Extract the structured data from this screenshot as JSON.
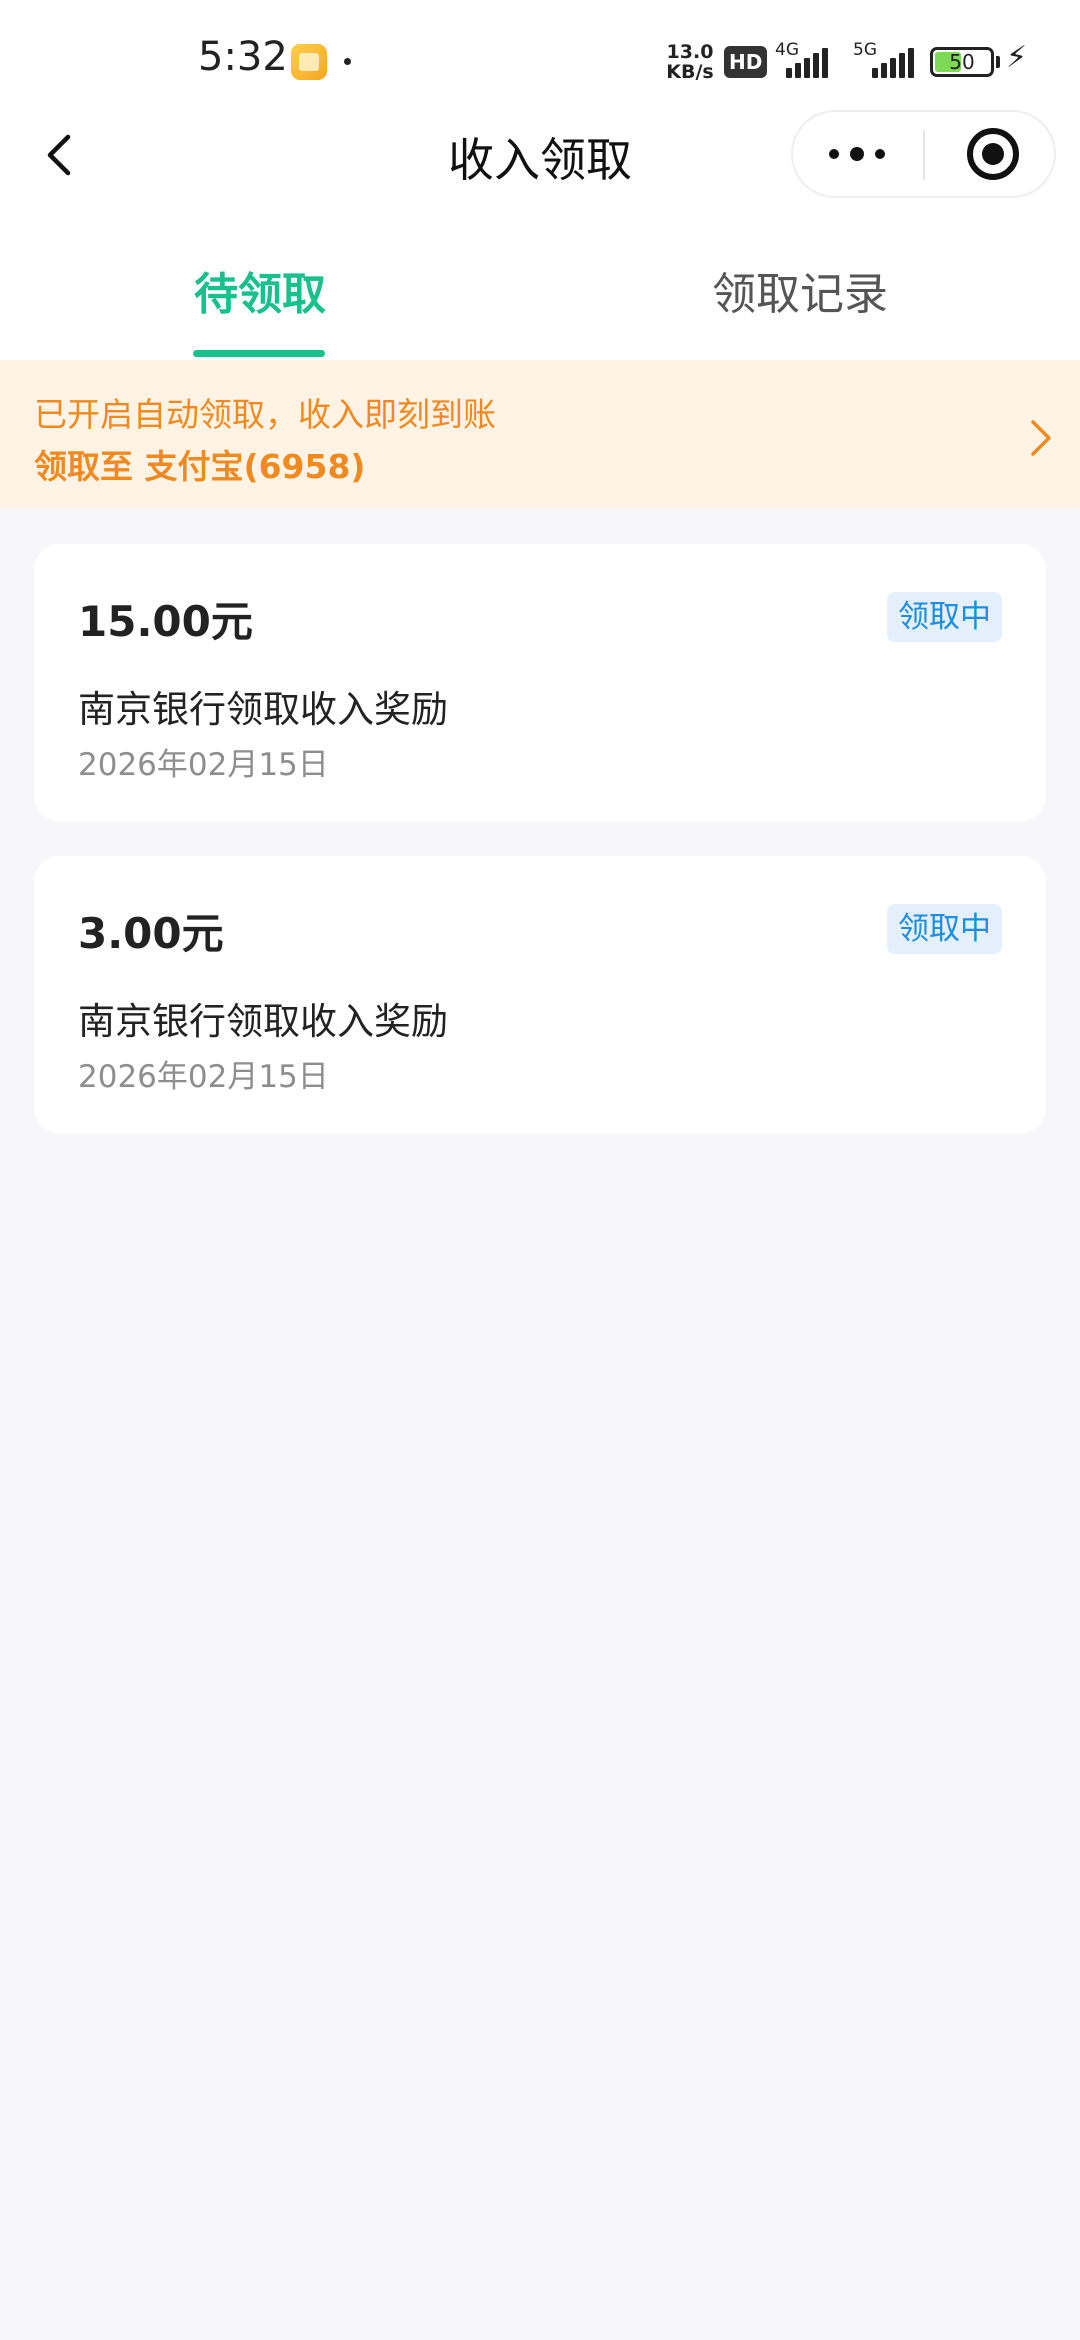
{
  "status_bar": {
    "time": "5:32",
    "app_icon": "gallery-icon",
    "speed_value": "13.0",
    "speed_unit": "KB/s",
    "hd_label": "HD",
    "network_1": "4G",
    "network_2": "5G",
    "battery_level": "50",
    "charging_icon": "bolt-icon"
  },
  "nav": {
    "back_icon": "chevron-left-icon",
    "title": "收入领取",
    "more_icon": "more-dots-icon",
    "close_icon": "record-circle-icon"
  },
  "tabs": [
    {
      "label": "待领取",
      "active": true
    },
    {
      "label": "领取记录",
      "active": false
    }
  ],
  "notice": {
    "line1": "已开启自动领取，收入即刻到账",
    "line2": "领取至 支付宝(6958)",
    "arrow_icon": "chevron-right-icon"
  },
  "records": [
    {
      "amount": "15.00元",
      "status": "领取中",
      "title": "南京银行领取收入奖励",
      "date": "2026年02月15日"
    },
    {
      "amount": "3.00元",
      "status": "领取中",
      "title": "南京银行领取收入奖励",
      "date": "2026年02月15日"
    }
  ],
  "colors": {
    "accent": "#18c08a",
    "notice_text": "#f08a1f",
    "notice_bg": "#fff3e5",
    "status_text": "#1e8de0",
    "status_bg": "#e4f1fc",
    "page_bg": "#f7f7f9"
  }
}
